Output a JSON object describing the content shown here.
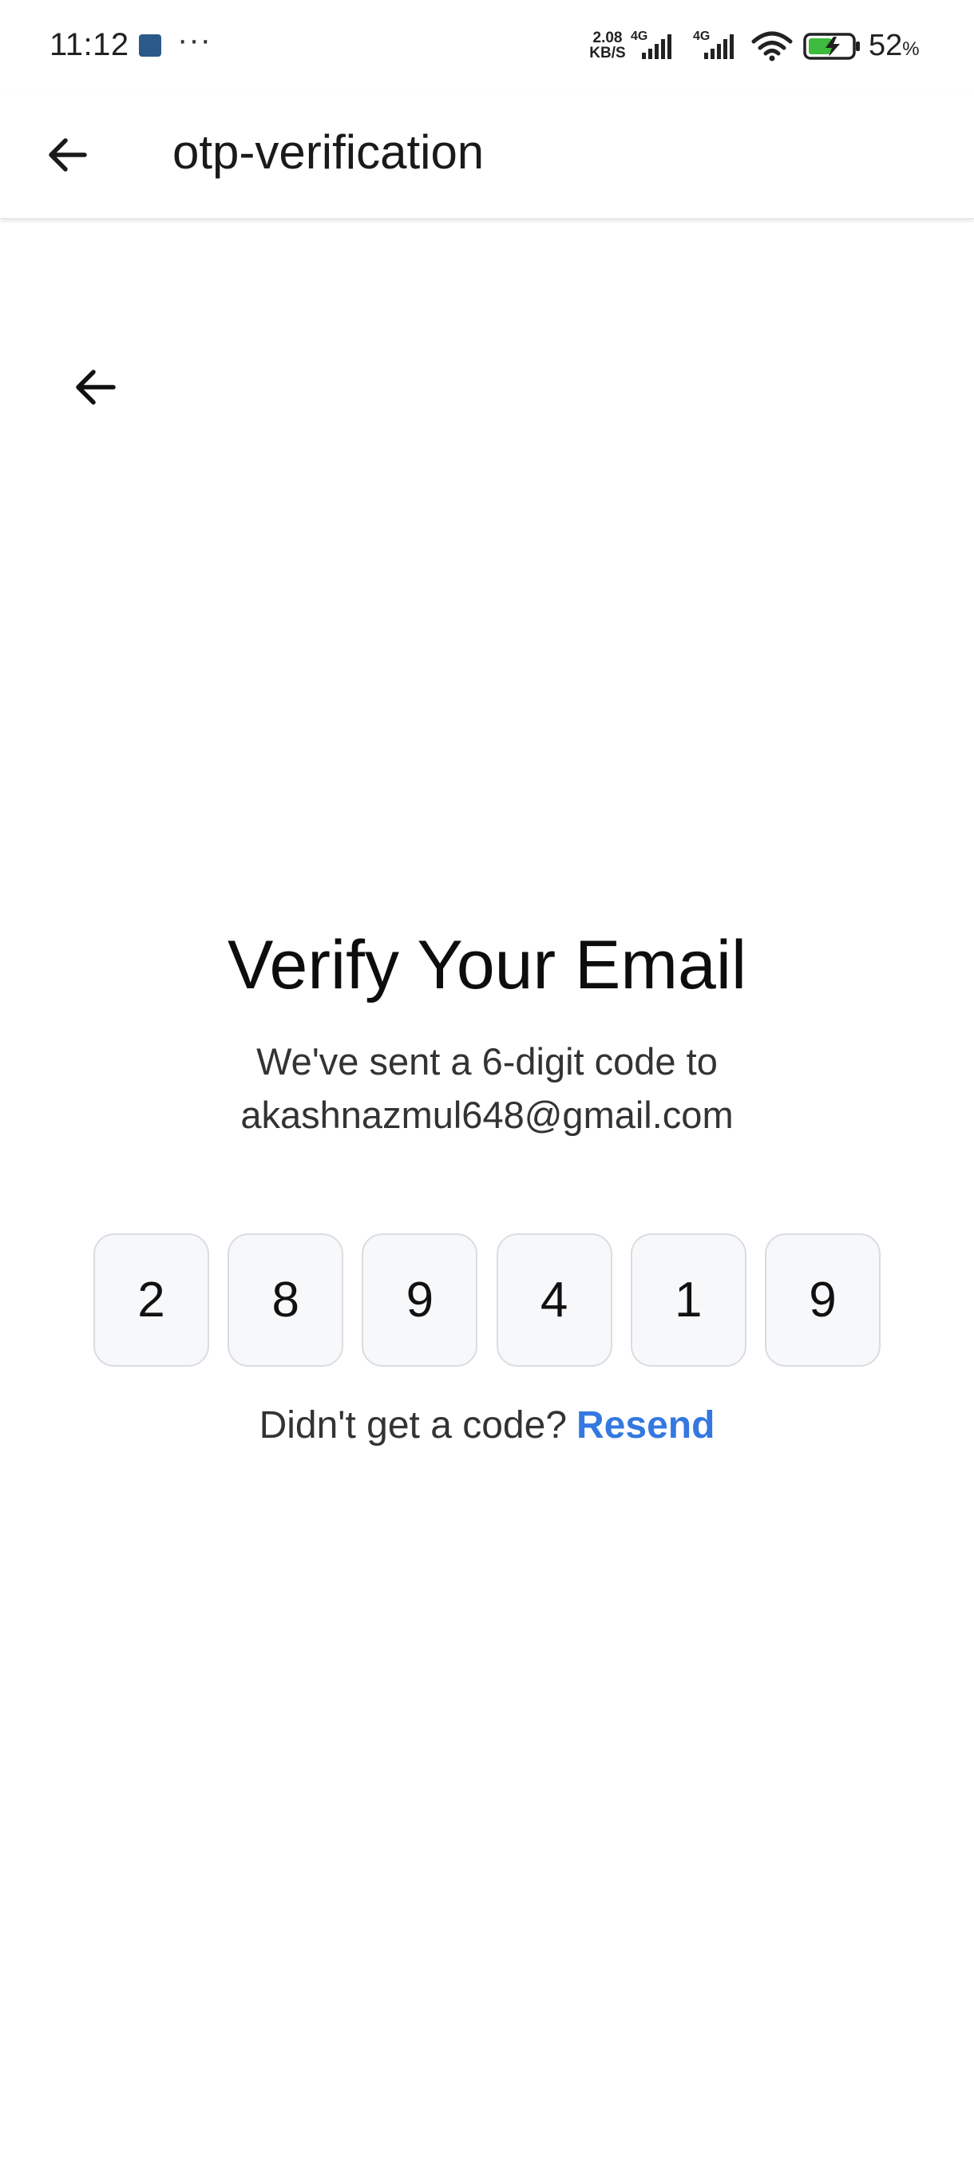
{
  "status_bar": {
    "time": "11:12",
    "more_indicator": "···",
    "net_speed_value": "2.08",
    "net_speed_unit": "KB/S",
    "signal_1_label": "4G",
    "signal_2_label": "4G",
    "battery_percent": "52",
    "battery_unit": "%",
    "icons": [
      "app-notification-icon",
      "signal-icon",
      "signal-icon",
      "wifi-icon",
      "battery-charging-icon"
    ]
  },
  "app_bar": {
    "title": "otp-verification",
    "back_icon": "arrow-left-icon"
  },
  "page": {
    "back_icon": "arrow-left-icon",
    "heading": "Verify Your Email",
    "subtitle_line1": "We've sent a 6-digit code to",
    "subtitle_line2": "akashnazmul648@gmail.com",
    "otp_digits": [
      "2",
      "8",
      "9",
      "4",
      "1",
      "9"
    ],
    "resend_prompt": "Didn't get a code?",
    "resend_label": "Resend"
  },
  "colors": {
    "accent": "#3478e0",
    "otp_box_bg": "#f7f8fa",
    "otp_box_border": "#d9dde2"
  }
}
